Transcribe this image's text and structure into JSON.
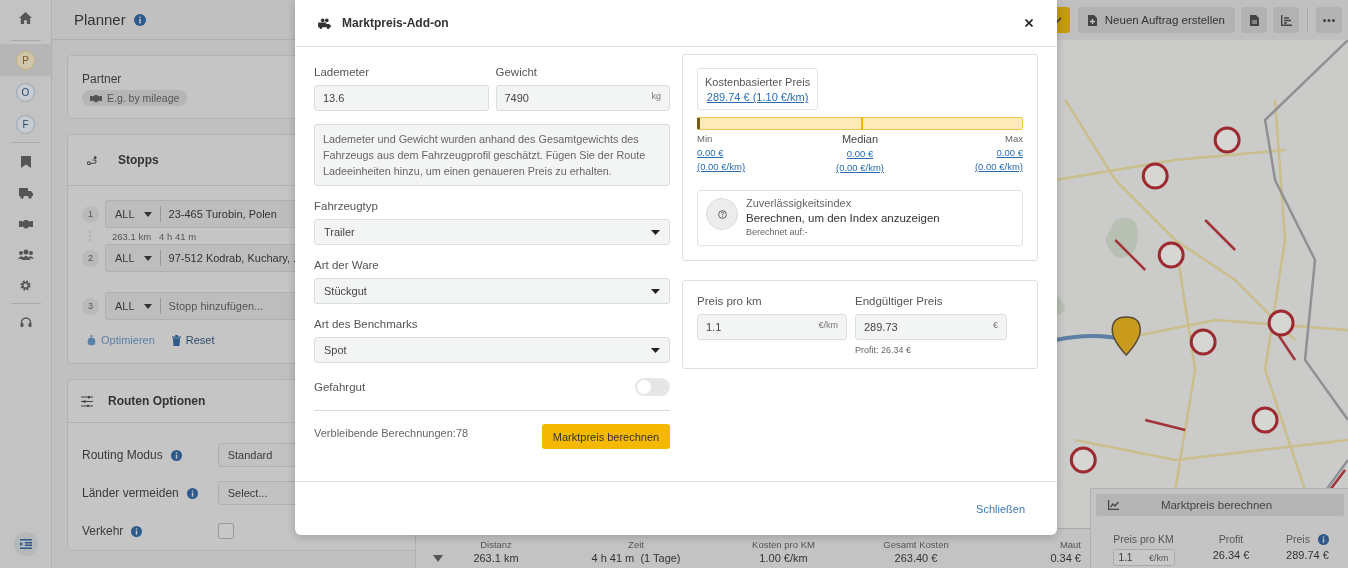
{
  "sidebar": {
    "profiles": [
      {
        "letter": "P",
        "selected": true
      },
      {
        "letter": "O",
        "selected": false
      },
      {
        "letter": "F",
        "selected": false
      }
    ]
  },
  "planner": {
    "title": "Planner",
    "partner": {
      "label": "Partner",
      "chip": "E.g. by mileage"
    },
    "stops": {
      "title": "Stopps",
      "rows": [
        {
          "number": "1",
          "type": "ALL",
          "address": "23-465 Turobin, Polen"
        },
        {
          "number": "2",
          "type": "ALL",
          "address": "97-512 Kodrab, Kuchary, ."
        },
        {
          "number": "3",
          "type": "ALL",
          "placeholder": "Stopp hinzufügen..."
        }
      ],
      "leg": {
        "distance": "263.1 km",
        "time": "4 h 41 m"
      },
      "optimize": "Optimieren",
      "reset": "Reset"
    },
    "route_options": {
      "title": "Routen Optionen",
      "fields": [
        {
          "kind": "select",
          "label": "Routing Modus",
          "value": "Standard"
        },
        {
          "kind": "select",
          "label": "Länder vermeiden",
          "placeholder": "Select..."
        },
        {
          "kind": "checkbox",
          "label": "Verkehr",
          "checked": false
        }
      ]
    }
  },
  "toolbar": {
    "create_button": "Neuen Auftrag erstellen"
  },
  "summary": {
    "columns": [
      {
        "label": "Distanz",
        "value": "263.1 km"
      },
      {
        "label": "Zeit",
        "value": "4 h 41 m",
        "note": "(1 Tage)"
      },
      {
        "label": "Kosten pro KM",
        "value": "1.00 €/km"
      },
      {
        "label": "Gesamt Kosten",
        "value": "263.40 €"
      },
      {
        "label": "Maut",
        "value": "0.34 €"
      }
    ]
  },
  "price_panel": {
    "button": "Marktpreis berechnen",
    "columns": [
      {
        "kind": "input",
        "label": "Preis pro KM",
        "value": "1.1",
        "unit": "€/km"
      },
      {
        "kind": "text",
        "label": "Profit",
        "value": "26.34 €"
      },
      {
        "kind": "text",
        "label": "Preis",
        "value": "289.74 €"
      }
    ]
  },
  "modal": {
    "title": "Marktpreis-Add-on",
    "lademeter": {
      "label": "Lademeter",
      "value": "13.6"
    },
    "gewicht": {
      "label": "Gewicht",
      "value": "7490",
      "unit": "kg"
    },
    "note": "Lademeter und Gewicht wurden anhand des Gesamtgewichts des Fahrzeugs aus dem Fahrzeugprofil geschätzt. Fügen Sie der Route Ladeeinheiten hinzu, um einen genaueren Preis zu erhalten.",
    "selects": [
      {
        "label": "Fahrzeugtyp",
        "value": "Trailer"
      },
      {
        "label": "Art der Ware",
        "value": "Stückgut"
      },
      {
        "label": "Art des Benchmarks",
        "value": "Spot"
      }
    ],
    "hazmat": {
      "label": "Gefahrgut",
      "on": false
    },
    "remaining": "Verbleibende Berechnungen:78",
    "calc_button": "Marktpreis berechnen",
    "cost_based": {
      "title": "Kostenbasierter Preis",
      "link": "289.74 € (1.10 €/km)"
    },
    "range": {
      "level": 0.5,
      "points": [
        {
          "label": "Min",
          "value": "0.00 €",
          "per_km": "(0.00 €/km)"
        },
        {
          "label": "Median",
          "value": "0.00 €",
          "per_km": "(0.00 €/km)"
        },
        {
          "label": "Max",
          "value": "0.00 €",
          "per_km": "(0.00 €/km)"
        }
      ]
    },
    "reliability": {
      "title": "Zuverlässigkeitsindex",
      "message": "Berechnen, um den Index anzuzeigen",
      "computed": "Berechnet auf:-"
    },
    "price_per_km": {
      "label": "Preis pro km",
      "value": "1.1",
      "unit": "€/km"
    },
    "final_price": {
      "label": "Endgültiger Preis",
      "value": "289.73",
      "unit": "€"
    },
    "profit": "Profit: 26.34 €",
    "close": "Schließen"
  }
}
